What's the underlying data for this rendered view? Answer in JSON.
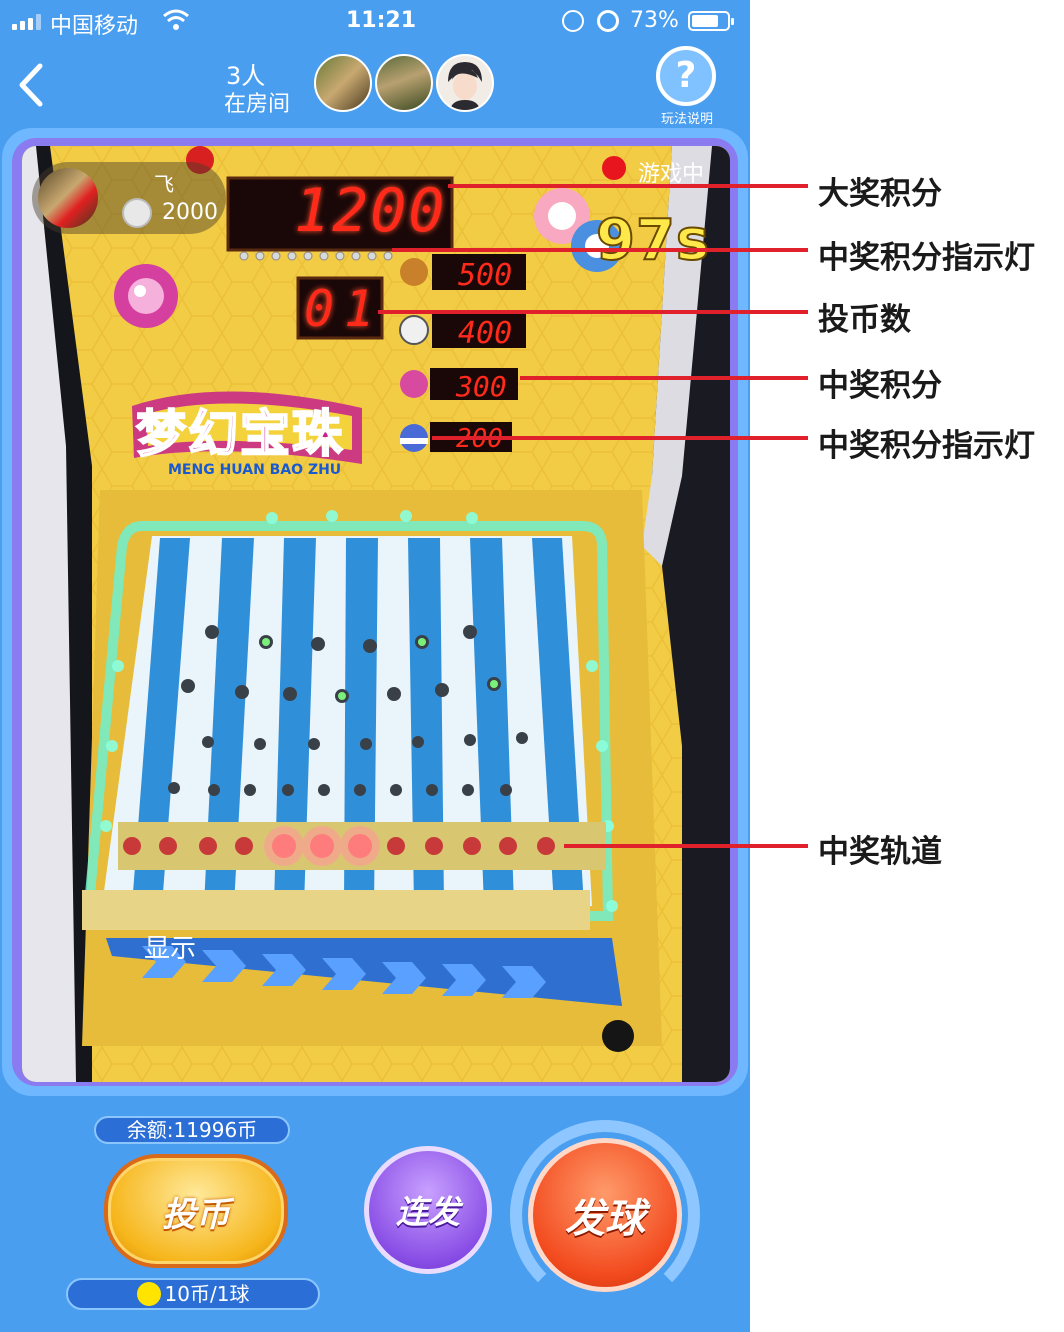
{
  "status_bar": {
    "carrier": "中国移动",
    "time": "11:21",
    "battery": "73%",
    "battery_level": 0.73,
    "icons": [
      "signal-icon",
      "wifi-icon",
      "rotation-lock-icon",
      "alarm-icon",
      "battery-icon"
    ]
  },
  "header": {
    "back_icon": "chevron-left-icon",
    "room_count": "3人",
    "room_label": "在房间",
    "help_glyph": "?",
    "help_label": "玩法说明"
  },
  "game": {
    "player_name": "飞",
    "player_score": "2000",
    "status_text": "游戏中",
    "timer": "97s",
    "jackpot_display": "1200",
    "coin_display": "01",
    "prize_values": [
      "500",
      "400",
      "300",
      "200"
    ],
    "logo_text": "梦幻宝珠",
    "logo_pinyin": "MENG HUAN BAO ZHU",
    "show_label": "显示"
  },
  "controls": {
    "balance": "余额:11996币",
    "insert_coin": "投币",
    "price": "10币/1球",
    "burst": "连发",
    "launch": "发球"
  },
  "annotations": {
    "jackpot_score": "大奖积分",
    "prize_indicator_1": "中奖积分指示灯",
    "coin_count": "投币数",
    "prize_score": "中奖积分",
    "prize_indicator_2": "中奖积分指示灯",
    "prize_track": "中奖轨道"
  },
  "colors": {
    "app_blue": "#4a9ef0",
    "annotation_line": "#e0202a",
    "led_red": "#ff2a1a",
    "machine_yellow": "#f0c83c",
    "lane_blue": "#2f8fd8"
  }
}
